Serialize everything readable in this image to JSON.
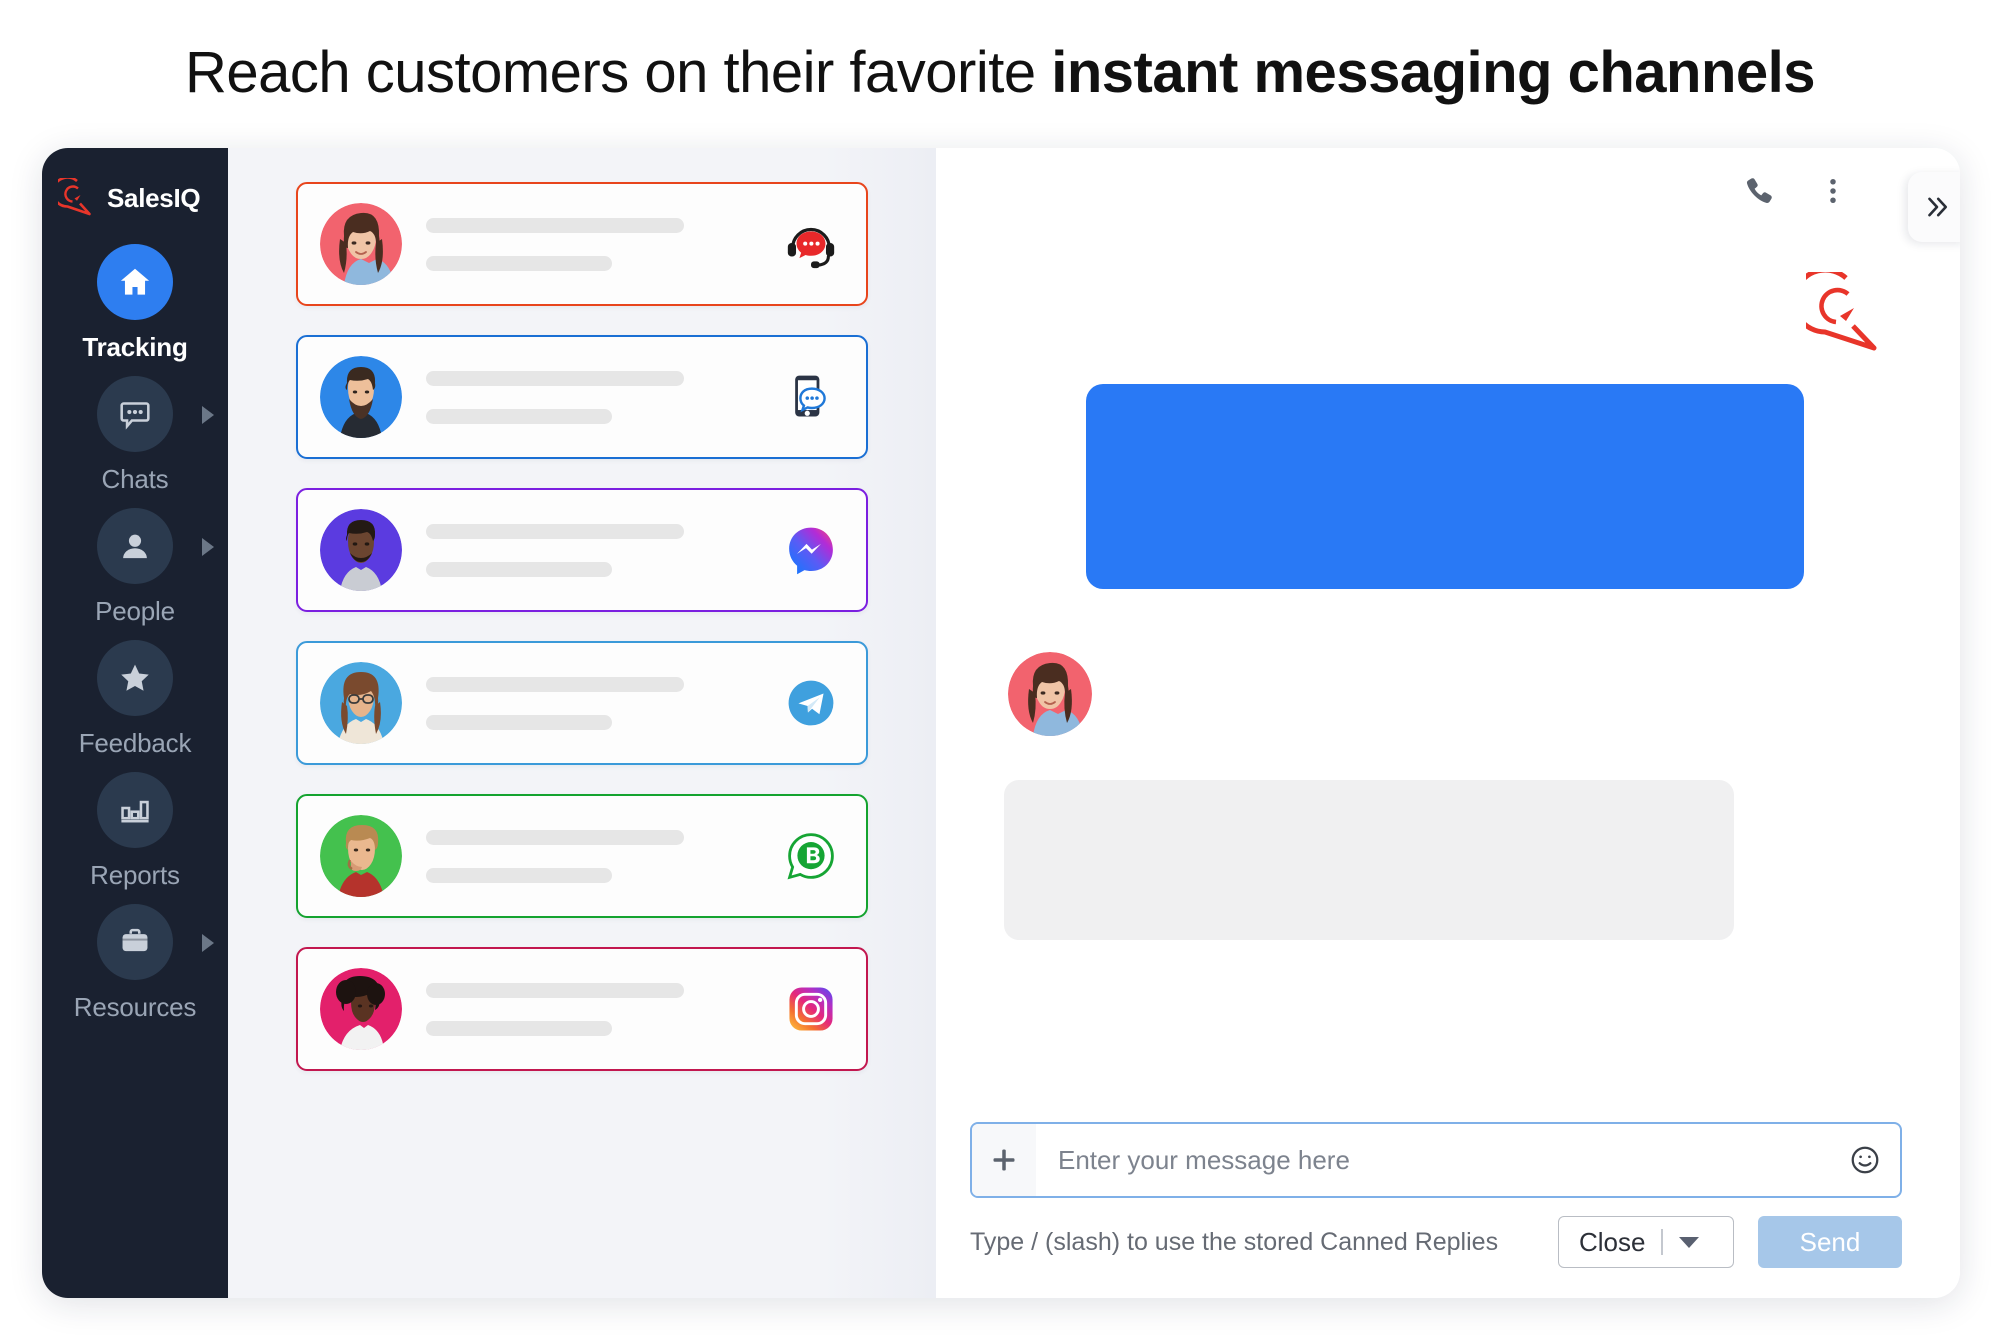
{
  "headline": {
    "light": "Reach customers on their favorite ",
    "bold": "instant messaging channels"
  },
  "sidebar": {
    "brand": {
      "name": "SalesIQ",
      "logo_icon": "salesiq-logo-icon",
      "logo_color": "#e8352a"
    },
    "active_color": "#2e7ef0",
    "items": [
      {
        "label": "Tracking",
        "icon": "home-icon",
        "active": true,
        "has_caret": false
      },
      {
        "label": "Chats",
        "icon": "chat-icon",
        "active": false,
        "has_caret": true
      },
      {
        "label": "People",
        "icon": "person-icon",
        "active": false,
        "has_caret": true
      },
      {
        "label": "Feedback",
        "icon": "star-icon",
        "active": false,
        "has_caret": false
      },
      {
        "label": "Reports",
        "icon": "bar-chart-icon",
        "active": false,
        "has_caret": false
      },
      {
        "label": "Resources",
        "icon": "briefcase-icon",
        "active": false,
        "has_caret": true
      }
    ]
  },
  "chat_list": {
    "cards": [
      {
        "channel": "live-chat",
        "icon": "headset-chat-icon",
        "border_color": "#e8451c",
        "avatar_bg": "#f2636e"
      },
      {
        "channel": "sms",
        "icon": "mobile-sms-icon",
        "border_color": "#1a6fd4",
        "avatar_bg": "#2d87e8"
      },
      {
        "channel": "facebook-messenger",
        "icon": "messenger-icon",
        "border_color": "#7b1fe0",
        "avatar_bg": "#5b3be0"
      },
      {
        "channel": "telegram",
        "icon": "telegram-icon",
        "border_color": "#3b9ad9",
        "avatar_bg": "#4aa8e0"
      },
      {
        "channel": "whatsapp-business",
        "icon": "whatsapp-business-icon",
        "border_color": "#14a32f",
        "avatar_bg": "#44c14e"
      },
      {
        "channel": "instagram",
        "icon": "instagram-icon",
        "border_color": "#c2174f",
        "avatar_bg": "#e3206b"
      }
    ]
  },
  "conversation": {
    "topbar": {
      "call_icon": "phone-icon",
      "menu_icon": "kebab-menu-icon",
      "expand_icon": "double-chevron-right-icon"
    },
    "watermark_icon": "salesiq-watermark-icon",
    "outgoing_bubble_color": "#2979f5",
    "incoming_bubble_color": "#f0f0f1",
    "incoming_avatar_bg": "#f2636e"
  },
  "composer": {
    "attach_icon": "plus-icon",
    "emoji_icon": "smiley-icon",
    "placeholder": "Enter your message here",
    "value": "",
    "hint": "Type / (slash) to use the stored Canned Replies",
    "status_select": {
      "value": "Close",
      "caret_icon": "chevron-down-icon"
    },
    "send_label": "Send",
    "send_color": "#a6c7e9"
  }
}
